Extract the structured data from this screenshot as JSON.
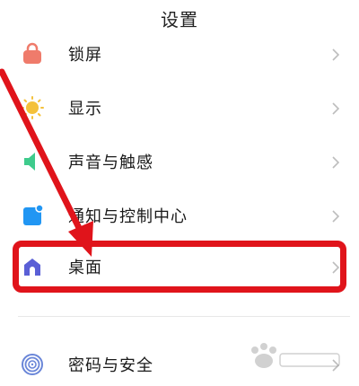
{
  "header": {
    "title": "设置"
  },
  "settings": {
    "items": [
      {
        "label": "锁屏",
        "icon": "lock-icon",
        "color": "#ef7b6b"
      },
      {
        "label": "显示",
        "icon": "sun-icon",
        "color": "#f4c13b"
      },
      {
        "label": "声音与触感",
        "icon": "speaker-icon",
        "color": "#3ecb8c"
      },
      {
        "label": "通知与控制中心",
        "icon": "notification-icon",
        "color": "#2196f3"
      },
      {
        "label": "桌面",
        "icon": "home-icon",
        "color": "#5a5fd6"
      },
      {
        "label": "密码与安全",
        "icon": "fingerprint-icon",
        "color": "#6a86d8"
      }
    ]
  },
  "annotation": {
    "color": "#e0141b"
  }
}
